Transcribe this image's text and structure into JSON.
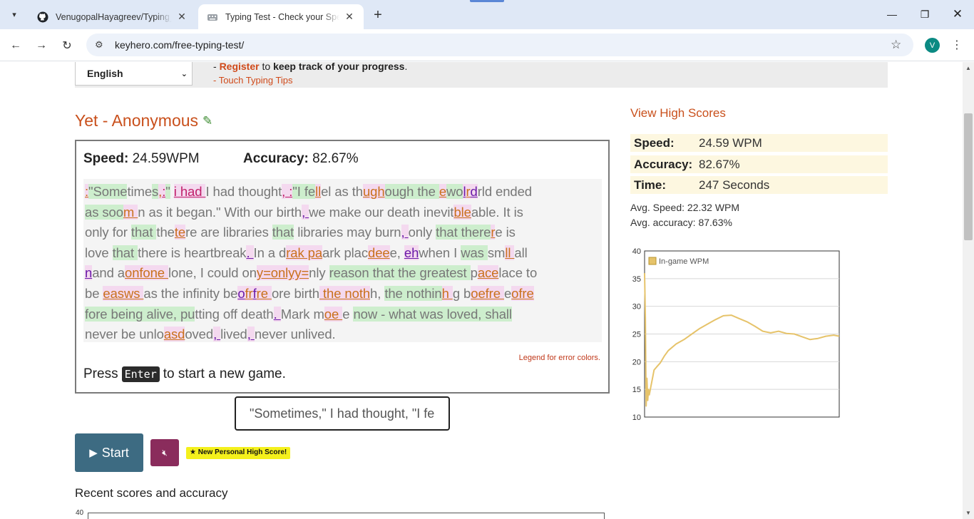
{
  "browser": {
    "tabs": [
      {
        "title": "VenugopalHayagreev/Typing_P",
        "icon": "github-icon"
      },
      {
        "title": "Typing Test - Check your Speed",
        "icon": "keyboard-icon"
      }
    ],
    "url": "keyhero.com/free-typing-test/",
    "profile_initial": "V"
  },
  "header": {
    "language": "English",
    "register_link": "Register",
    "register_rest": " to ",
    "register_bold": "keep track of your progress",
    "register_dot": ".",
    "register_dash": "- ",
    "tips_link": "- Touch Typing Tips"
  },
  "player": {
    "name": "Yet - Anonymous"
  },
  "result": {
    "speed_label": "Speed:",
    "speed_value": " 24.59WPM",
    "accuracy_label": "Accuracy:",
    "accuracy_value": " 82.67%",
    "legend_link": "Legend for error colors.",
    "press": "Press",
    "enter_key": "Enter",
    "press_rest": "to start a new game."
  },
  "typed_lines": [
    [
      [
        "o",
        ":"
      ],
      [
        "g",
        "\"Some"
      ],
      [
        "n",
        "time"
      ],
      [
        "g",
        "s"
      ],
      [
        "o",
        ","
      ],
      [
        "mg",
        ":"
      ],
      [
        "g",
        "\""
      ],
      [
        "n",
        " "
      ],
      [
        "mg",
        "i had "
      ],
      [
        "n",
        "I had thought"
      ],
      [
        "mg",
        ", :"
      ],
      [
        "g",
        "\"I fe"
      ],
      [
        "o",
        "ll"
      ],
      [
        "n",
        "el as th"
      ],
      [
        "o",
        "ugh"
      ],
      [
        "g",
        "ough the "
      ],
      [
        "o",
        "e"
      ],
      [
        "g",
        "wo"
      ],
      [
        "v",
        "l"
      ],
      [
        "o",
        "r"
      ],
      [
        "v",
        "d"
      ],
      [
        "n",
        "rld ended"
      ]
    ],
    [
      [
        "g",
        "as soo"
      ],
      [
        "o",
        "m "
      ],
      [
        "n",
        "n as it began.\" With our birth"
      ],
      [
        "v",
        ", "
      ],
      [
        "n",
        "we make our death inevit"
      ],
      [
        "o",
        "ble"
      ],
      [
        "n",
        "able. It is"
      ]
    ],
    [
      [
        "n",
        "only for "
      ],
      [
        "g",
        "that "
      ],
      [
        "n",
        "the"
      ],
      [
        "o",
        "te"
      ],
      [
        "n",
        "re are libraries "
      ],
      [
        "g",
        "that"
      ],
      [
        "n",
        " libraries may burn"
      ],
      [
        "v",
        ", "
      ],
      [
        "n",
        "only "
      ],
      [
        "g",
        "that there"
      ],
      [
        "o",
        "r"
      ],
      [
        "n",
        "e is"
      ]
    ],
    [
      [
        "n",
        "love "
      ],
      [
        "g",
        "that "
      ],
      [
        "n",
        "there is heartbreak"
      ],
      [
        "v",
        ". "
      ],
      [
        "n",
        "In a d"
      ],
      [
        "o",
        "rak pa"
      ],
      [
        "n",
        "ark plac"
      ],
      [
        "o",
        "dee"
      ],
      [
        "n",
        "e, "
      ],
      [
        "v",
        "eh"
      ],
      [
        "n",
        "when I "
      ],
      [
        "g",
        "was "
      ],
      [
        "n",
        "sm"
      ],
      [
        "o",
        "ll "
      ],
      [
        "n",
        "all"
      ]
    ],
    [
      [
        "v",
        "n"
      ],
      [
        "n",
        "and a"
      ],
      [
        "o",
        "onfone "
      ],
      [
        "n",
        "lone, I could on"
      ],
      [
        "o",
        "y=onlyy="
      ],
      [
        "n",
        "nly "
      ],
      [
        "g",
        "reason that the greatest "
      ],
      [
        "n",
        "p"
      ],
      [
        "o",
        "ace"
      ],
      [
        "n",
        "lace to"
      ]
    ],
    [
      [
        "n",
        "be "
      ],
      [
        "o",
        "easws "
      ],
      [
        "n",
        "as the infinity be"
      ],
      [
        "v",
        "o"
      ],
      [
        "o",
        "fr"
      ],
      [
        "v",
        "f"
      ],
      [
        "o",
        "re "
      ],
      [
        "n",
        "ore birth"
      ],
      [
        "o",
        " the noth"
      ],
      [
        "n",
        "h, "
      ],
      [
        "g",
        "the nothin"
      ],
      [
        "o",
        "h "
      ],
      [
        "n",
        "g b"
      ],
      [
        "o",
        "oefre "
      ],
      [
        "n",
        "e"
      ],
      [
        "o",
        "ofre"
      ]
    ],
    [
      [
        "g",
        "fore being alive, pu"
      ],
      [
        "n",
        "tting off death"
      ],
      [
        "v",
        ". "
      ],
      [
        "n",
        "Mark m"
      ],
      [
        "o",
        "oe "
      ],
      [
        "n",
        "e "
      ],
      [
        "g",
        "now - what was loved, shall"
      ]
    ],
    [
      [
        "n",
        "never be unlo"
      ],
      [
        "o",
        "asd"
      ],
      [
        "n",
        "oved"
      ],
      [
        "v",
        ", "
      ],
      [
        "n",
        "lived"
      ],
      [
        "v",
        ", "
      ],
      [
        "n",
        "never unlived."
      ]
    ]
  ],
  "input": {
    "value": "\"Sometimes,\" I had thought, \"I fe"
  },
  "controls": {
    "start": "Start",
    "high_score_badge": "★ New Personal High Score!"
  },
  "recent": {
    "title": "Recent scores and accuracy",
    "ytick": "40"
  },
  "sidebar": {
    "view_high_scores": "View High Scores",
    "rows": [
      {
        "label": "Speed:",
        "value": "24.59 WPM"
      },
      {
        "label": "Accuracy:",
        "value": "82.67%"
      },
      {
        "label": "Time:",
        "value": "247 Seconds"
      }
    ],
    "avg_speed": "Avg. Speed: 22.32 WPM",
    "avg_accuracy": "Avg. accuracy: 87.63%"
  },
  "chart_data": {
    "type": "line",
    "title": "",
    "legend": "In-game WPM",
    "legend_position": "top-left",
    "line_color": "#e6c36a",
    "ylim": [
      10,
      40
    ],
    "yticks": [
      10,
      15,
      20,
      25,
      30,
      35,
      40
    ],
    "grid": true,
    "series": [
      {
        "name": "In-game WPM",
        "x": [
          0,
          1,
          2,
          3,
          4,
          5,
          6,
          8,
          10,
          12,
          15,
          20,
          25,
          30,
          40,
          50,
          60,
          70,
          80,
          90,
          100,
          110,
          120,
          130,
          140,
          150,
          160,
          170,
          180,
          190,
          200,
          210,
          220,
          230,
          240,
          247
        ],
        "values": [
          36,
          28,
          12,
          17,
          13,
          15,
          14,
          15.5,
          17,
          18.5,
          19,
          19.8,
          21,
          22,
          23.2,
          24,
          25,
          26,
          26.8,
          27.6,
          28.3,
          28.4,
          27.8,
          27.2,
          26.4,
          25.5,
          25.2,
          25.5,
          25.1,
          25.0,
          24.5,
          24.0,
          24.2,
          24.6,
          24.8,
          24.6
        ]
      }
    ]
  }
}
